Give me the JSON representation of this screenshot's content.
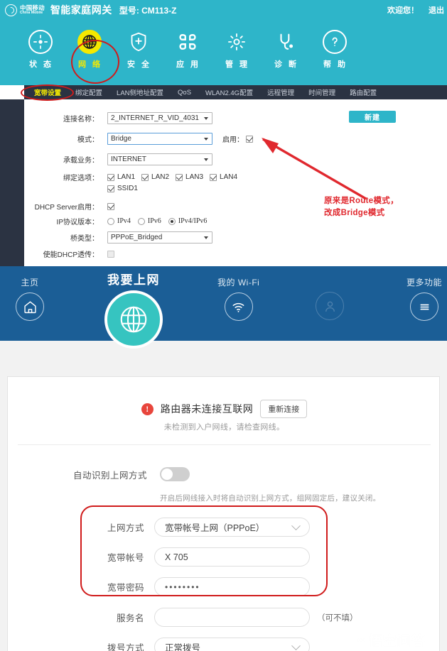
{
  "router_admin": {
    "brand_cn": "中国移动",
    "brand_en": "China Mobile",
    "title": "智能家庭网关",
    "model": "型号: CM113-Z",
    "welcome": "欢迎您！",
    "logout": "退出",
    "nav": [
      {
        "label": "状 态",
        "icon": "status-target-icon",
        "active": false
      },
      {
        "label": "网 络",
        "icon": "globe-icon",
        "active": true
      },
      {
        "label": "安 全",
        "icon": "shield-plus-icon",
        "active": false
      },
      {
        "label": "应 用",
        "icon": "apps-grid-icon",
        "active": false
      },
      {
        "label": "管 理",
        "icon": "gear-icon",
        "active": false
      },
      {
        "label": "诊 断",
        "icon": "stethoscope-icon",
        "active": false
      },
      {
        "label": "帮 助",
        "icon": "question-circle-icon",
        "active": false
      }
    ],
    "subnav": [
      {
        "label": "宽带设置",
        "active": true
      },
      {
        "label": "绑定配置",
        "active": false
      },
      {
        "label": "LAN侧地址配置",
        "active": false
      },
      {
        "label": "QoS",
        "active": false
      },
      {
        "label": "WLAN2.4G配置",
        "active": false
      },
      {
        "label": "远程管理",
        "active": false
      },
      {
        "label": "时间管理",
        "active": false
      },
      {
        "label": "路由配置",
        "active": false
      }
    ],
    "new_button": "新建",
    "form": {
      "conn_name_label": "连接名称：",
      "conn_name_value": "2_INTERNET_R_VID_4031",
      "mode_label": "模式：",
      "mode_value": "Bridge",
      "enable_label": "启用：",
      "service_label": "承载业务：",
      "service_value": "INTERNET",
      "bind_label": "绑定选项：",
      "bind_lan": [
        "LAN1",
        "LAN2",
        "LAN3",
        "LAN4"
      ],
      "bind_ssid": "SSID1",
      "dhcp_label": "DHCP Server启用：",
      "ipver_label": "IP协议版本：",
      "ipver_options": [
        "IPv4",
        "IPv6",
        "IPv4/IPv6"
      ],
      "ipver_selected": "IPv4/IPv6",
      "bridge_type_label": "桥类型：",
      "bridge_type_value": "PPPoE_Bridged",
      "dhcp_relay_label": "使能DHCP透传："
    },
    "annotation_line1": "原来是Route模式，",
    "annotation_line2": "改成Bridge模式"
  },
  "router_app": {
    "nav": [
      {
        "label": "主页",
        "icon": "home-icon"
      },
      {
        "label": "我要上网",
        "icon": "globe-icon"
      },
      {
        "label": "我的 Wi-Fi",
        "icon": "wifi-icon"
      },
      {
        "label": "",
        "icon": "user-icon"
      },
      {
        "label": "更多功能",
        "icon": "hamburger-menu-icon"
      }
    ],
    "status": {
      "icon": "!",
      "message": "路由器未连接互联网",
      "action": "重新连接",
      "detail": "未检测到入户网线，请检查网线。"
    },
    "auto_detect_label": "自动识别上网方式",
    "auto_detect_hint": "开启后网线接入时将自动识别上网方式，组网固定后，建议关闭。",
    "fields": {
      "mode_label": "上网方式",
      "mode_value": "宽带帐号上网（PPPoE）",
      "account_label": "宽带帐号",
      "account_value": "X            705",
      "password_label": "宽带密码",
      "password_value": "••••••••",
      "service_name_label": "服务名",
      "service_name_value": "",
      "service_name_note": "（可不填）",
      "dial_label": "拨号方式",
      "dial_value": "正常拨号"
    }
  },
  "watermark": {
    "logo": "∞",
    "text": "悟空问答"
  }
}
